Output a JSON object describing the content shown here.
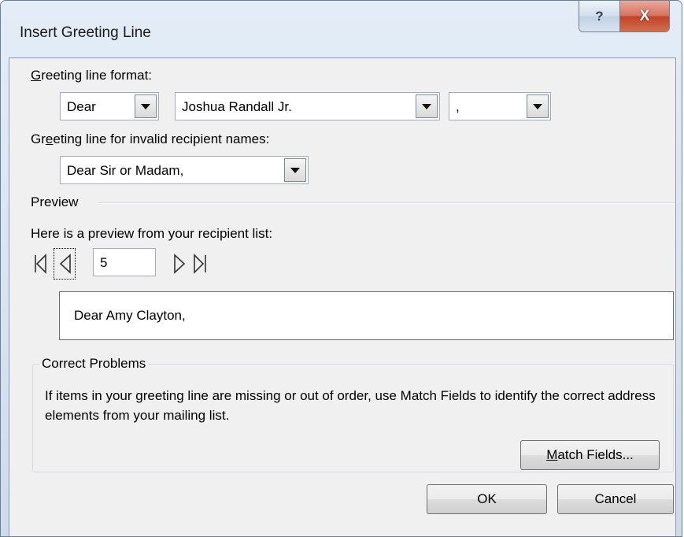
{
  "window": {
    "title": "Insert Greeting Line",
    "help_glyph": "?",
    "close_glyph": "X"
  },
  "greeting_format": {
    "label_prefix": "G",
    "label_rest": "reeting line format:",
    "salutation": "Dear",
    "name_format": "Joshua Randall Jr.",
    "punctuation": ","
  },
  "invalid": {
    "label_pre": "Gr",
    "label_accel": "e",
    "label_rest": "eting line for invalid recipient names:",
    "value": "Dear Sir or Madam,"
  },
  "preview": {
    "section_title": "Preview",
    "description": "Here is a preview from your recipient list:",
    "record_number": "5",
    "text": "Dear Amy Clayton,"
  },
  "correct": {
    "section_title": "Correct Problems",
    "text": "If items in your greeting line are missing or out of order, use Match Fields to identify the correct address elements from your mailing list.",
    "match_accel": "M",
    "match_rest": "atch Fields..."
  },
  "buttons": {
    "ok": "OK",
    "cancel": "Cancel"
  },
  "colors": {
    "close_red": "#c2432a",
    "dialog_bg": "#f0f0f0",
    "frame_blue": "#d6e3f1"
  }
}
